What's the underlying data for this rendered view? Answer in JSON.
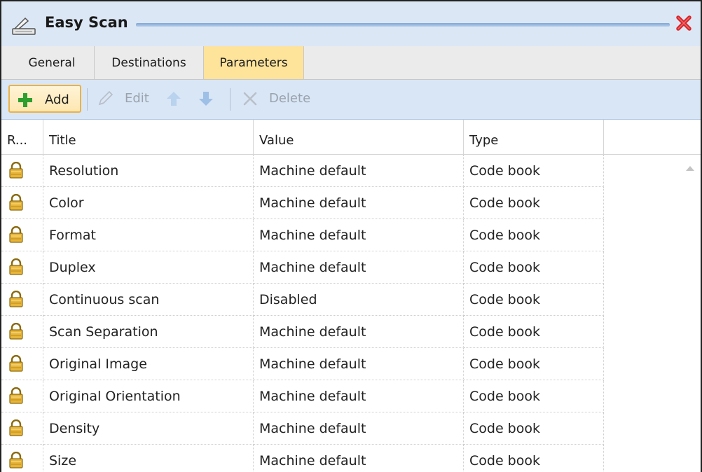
{
  "window": {
    "title": "Easy Scan",
    "icon": "scanner-icon",
    "close_icon": "close-icon",
    "title_bg": "#dce7f5",
    "close_color": "#d7262b"
  },
  "tabs": [
    {
      "label": "General",
      "active": false
    },
    {
      "label": "Destinations",
      "active": false
    },
    {
      "label": "Parameters",
      "active": true
    }
  ],
  "toolbar": {
    "add_label": "Add",
    "edit_label": "Edit",
    "delete_label": "Delete",
    "move_up_icon": "arrow-up-icon",
    "move_down_icon": "arrow-down-icon"
  },
  "grid": {
    "columns": [
      "R...",
      "Title",
      "Value",
      "Type"
    ],
    "rows": [
      {
        "icon": "lock-icon",
        "title": "Resolution",
        "value": "Machine default",
        "type": "Code book"
      },
      {
        "icon": "lock-icon",
        "title": "Color",
        "value": "Machine default",
        "type": "Code book"
      },
      {
        "icon": "lock-icon",
        "title": "Format",
        "value": "Machine default",
        "type": "Code book"
      },
      {
        "icon": "lock-icon",
        "title": "Duplex",
        "value": "Machine default",
        "type": "Code book"
      },
      {
        "icon": "lock-icon",
        "title": "Continuous scan",
        "value": "Disabled",
        "type": "Code book"
      },
      {
        "icon": "lock-icon",
        "title": "Scan Separation",
        "value": "Machine default",
        "type": "Code book"
      },
      {
        "icon": "lock-icon",
        "title": "Original Image",
        "value": "Machine default",
        "type": "Code book"
      },
      {
        "icon": "lock-icon",
        "title": "Original Orientation",
        "value": "Machine default",
        "type": "Code book"
      },
      {
        "icon": "lock-icon",
        "title": "Density",
        "value": "Machine default",
        "type": "Code book"
      },
      {
        "icon": "lock-icon",
        "title": "Size",
        "value": "Machine default",
        "type": "Code book"
      }
    ]
  },
  "colors": {
    "active_tab": "#fee39b",
    "toolbar_bg": "#d9e6f6",
    "add_icon": "#2e9e2e",
    "lock_icon": "#d4a017"
  }
}
